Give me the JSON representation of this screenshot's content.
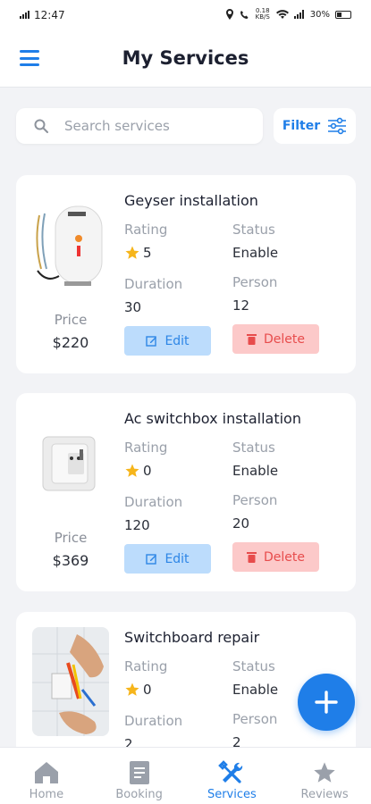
{
  "status_bar": {
    "time": "12:47",
    "network": "0.18 KB/S",
    "battery": "30%"
  },
  "header": {
    "title": "My Services"
  },
  "search": {
    "placeholder": "Search services"
  },
  "filter": {
    "label": "Filter"
  },
  "labels": {
    "rating": "Rating",
    "status": "Status",
    "duration": "Duration",
    "person": "Person",
    "price": "Price",
    "edit": "Edit",
    "delete": "Delete"
  },
  "services": [
    {
      "title": "Geyser installation",
      "rating": "5",
      "status": "Enable",
      "duration": "30",
      "person": "12",
      "price": "$220",
      "image": "geyser-image"
    },
    {
      "title": "Ac switchbox installation",
      "rating": "0",
      "status": "Enable",
      "duration": "120",
      "person": "20",
      "price": "$369",
      "image": "switchbox-image"
    },
    {
      "title": "Switchboard repair",
      "rating": "0",
      "status": "Enable",
      "duration": "2",
      "person": "2",
      "price": "",
      "image": "switchboard-repair-image"
    }
  ],
  "nav": {
    "items": [
      {
        "label": "Home",
        "icon": "home-icon"
      },
      {
        "label": "Booking",
        "icon": "booking-icon"
      },
      {
        "label": "Services",
        "icon": "services-icon"
      },
      {
        "label": "Reviews",
        "icon": "star-icon"
      }
    ],
    "active": "Services"
  },
  "colors": {
    "accent": "#1f7ee8",
    "edit_bg": "#bcdcfc",
    "delete_bg": "#fcc9c9",
    "delete_text": "#e74c4c",
    "star": "#f6b51b"
  }
}
